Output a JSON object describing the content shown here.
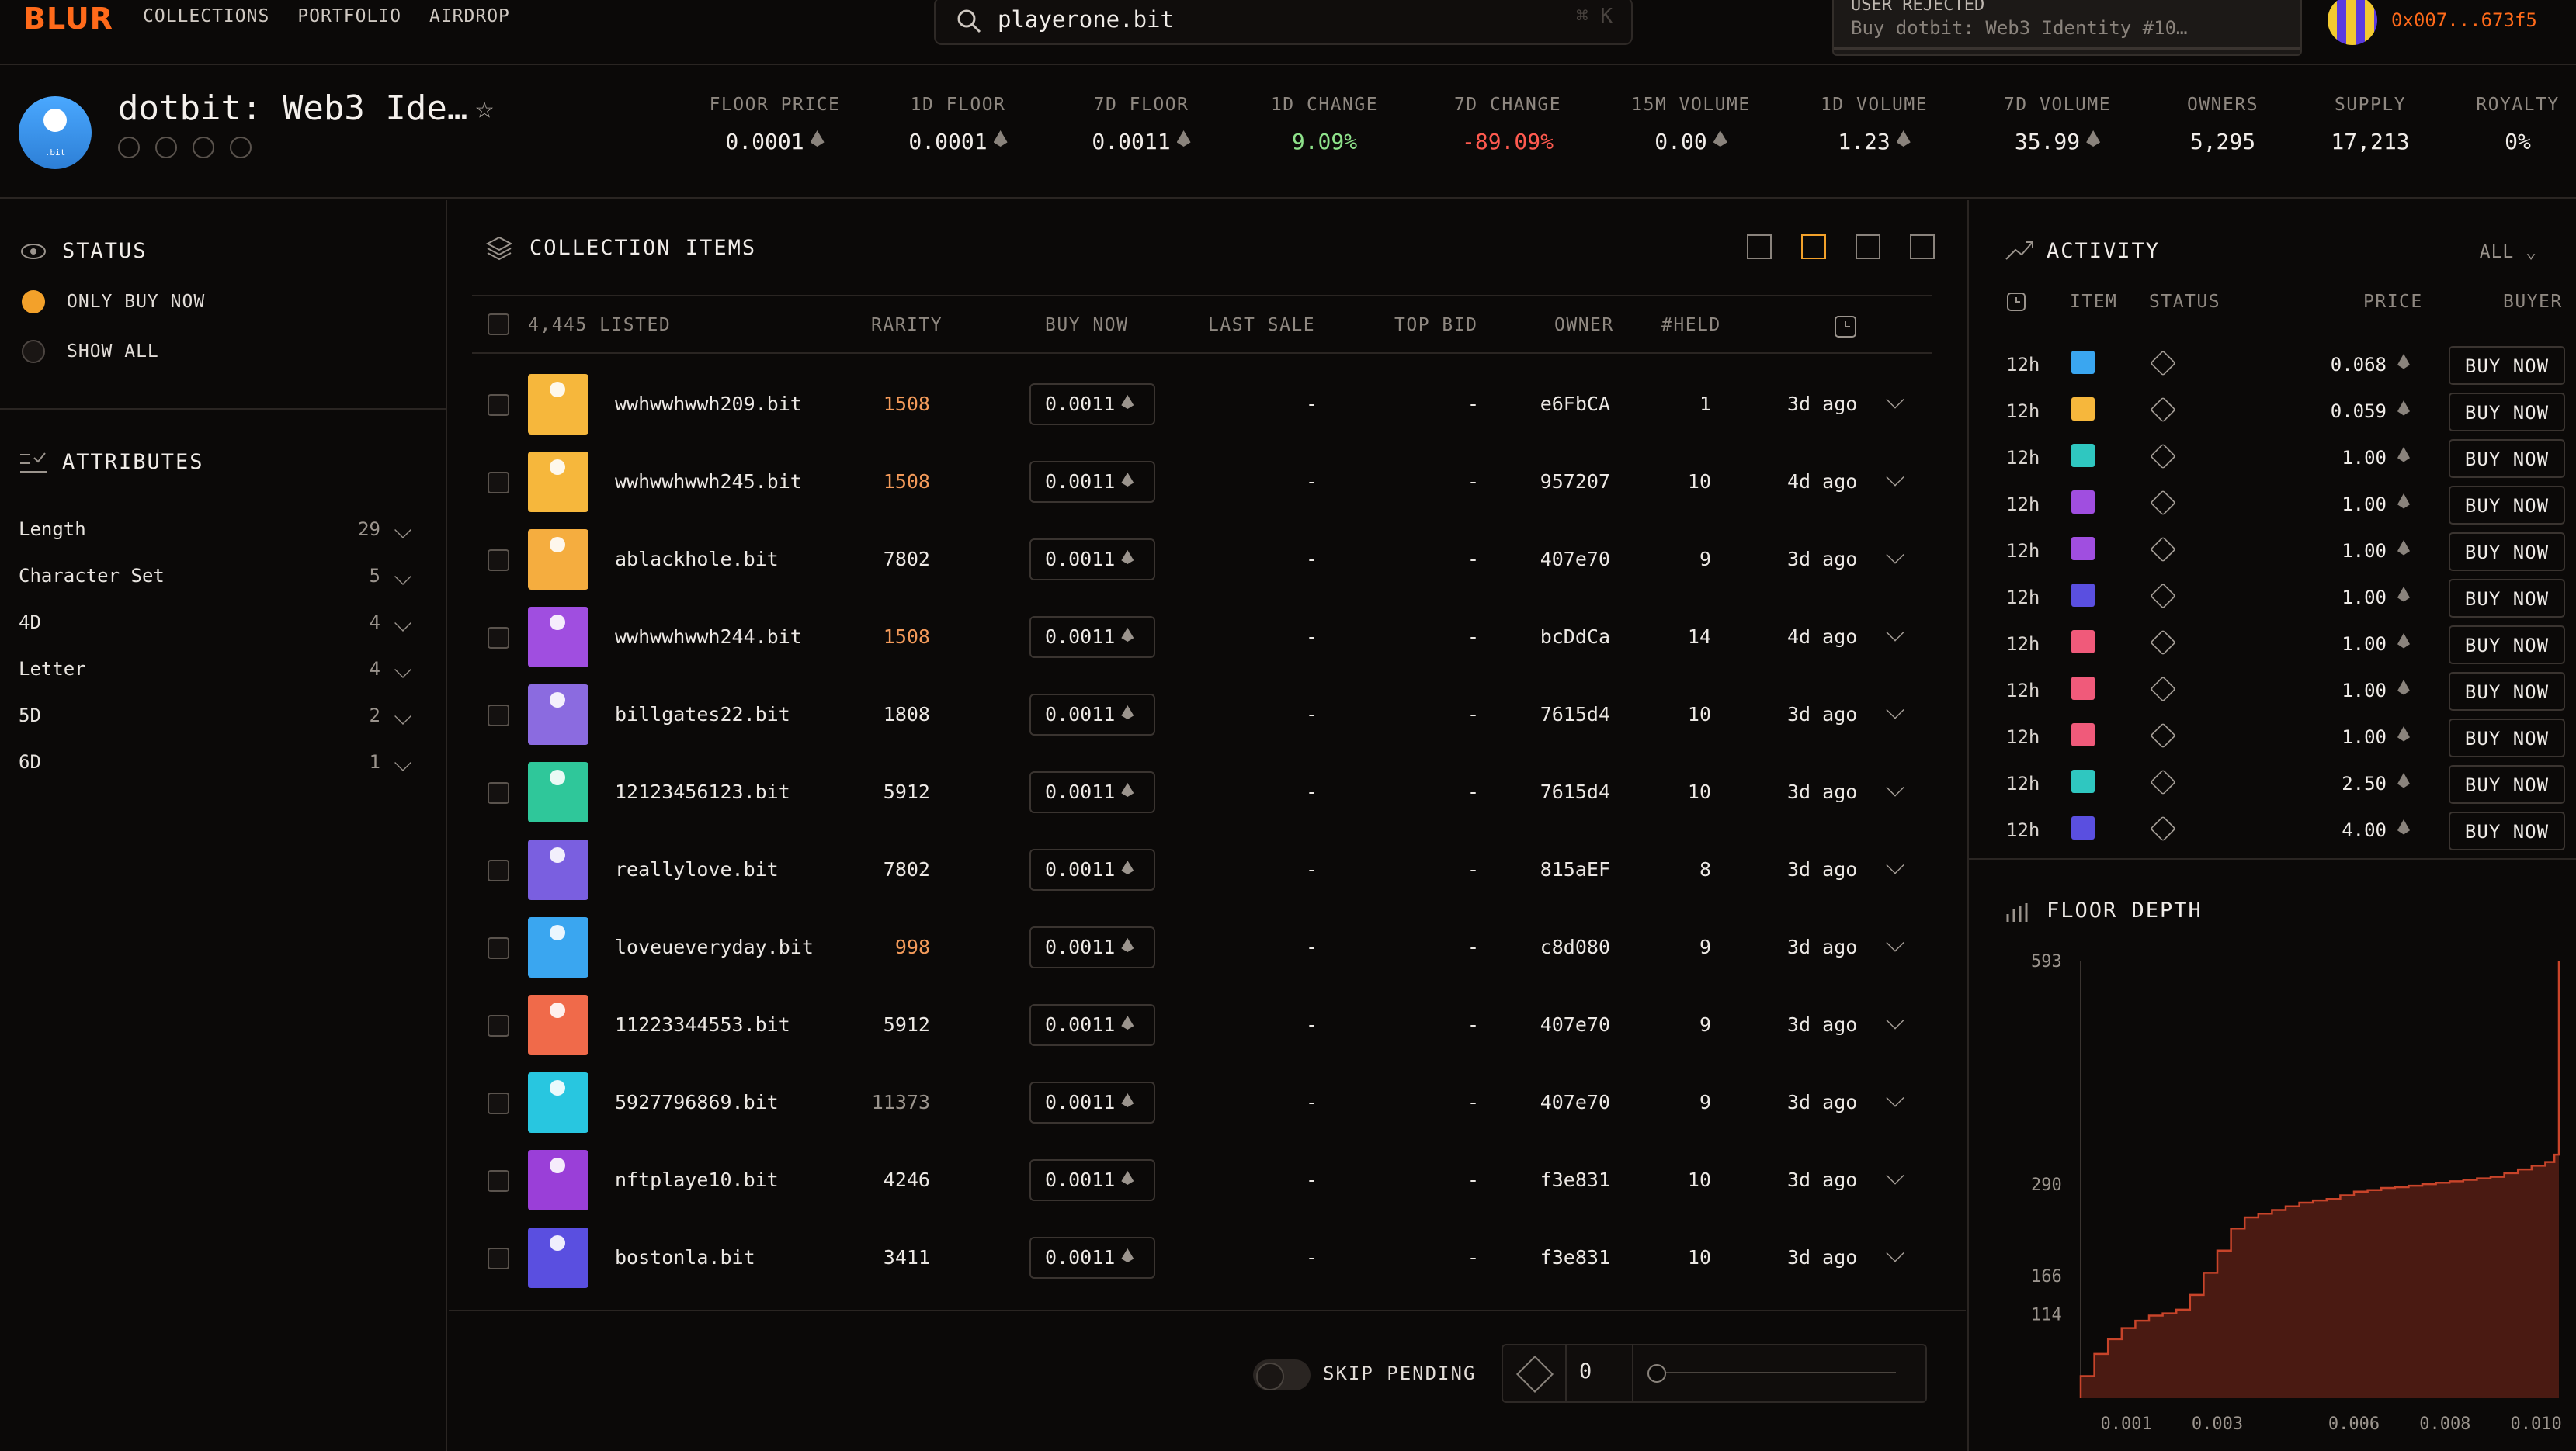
{
  "nav": {
    "logo": "BLUR",
    "links": [
      "COLLECTIONS",
      "PORTFOLIO",
      "AIRDROP"
    ]
  },
  "search": {
    "value": "playerone.bit",
    "shortcut": "⌘ K"
  },
  "toast": {
    "title": "USER REJECTED",
    "message": "Buy dotbit: Web3 Identity #10…"
  },
  "wallet": {
    "address": "0x007...673f5"
  },
  "collection": {
    "name": "dotbit: Web3 Ide…",
    "stats": [
      {
        "label": "FLOOR PRICE",
        "value": "0.0001",
        "eth": true,
        "tone": ""
      },
      {
        "label": "1D FLOOR",
        "value": "0.0001",
        "eth": true,
        "tone": ""
      },
      {
        "label": "7D FLOOR",
        "value": "0.0011",
        "eth": true,
        "tone": ""
      },
      {
        "label": "1D CHANGE",
        "value": "9.09%",
        "eth": false,
        "tone": "pos"
      },
      {
        "label": "7D CHANGE",
        "value": "-89.09%",
        "eth": false,
        "tone": "neg"
      },
      {
        "label": "15M VOLUME",
        "value": "0.00",
        "eth": true,
        "tone": ""
      },
      {
        "label": "1D VOLUME",
        "value": "1.23",
        "eth": true,
        "tone": ""
      },
      {
        "label": "7D VOLUME",
        "value": "35.99",
        "eth": true,
        "tone": ""
      },
      {
        "label": "OWNERS",
        "value": "5,295",
        "eth": false,
        "tone": ""
      },
      {
        "label": "SUPPLY",
        "value": "17,213",
        "eth": false,
        "tone": ""
      },
      {
        "label": "ROYALTY",
        "value": "0%",
        "eth": false,
        "tone": ""
      }
    ]
  },
  "status": {
    "title": "STATUS",
    "options": [
      {
        "label": "ONLY BUY NOW",
        "selected": true
      },
      {
        "label": "SHOW ALL",
        "selected": false
      }
    ]
  },
  "attributes": {
    "title": "ATTRIBUTES",
    "items": [
      {
        "name": "Length",
        "count": "29"
      },
      {
        "name": "Character Set",
        "count": "5"
      },
      {
        "name": "4D",
        "count": "4"
      },
      {
        "name": "Letter",
        "count": "4"
      },
      {
        "name": "5D",
        "count": "2"
      },
      {
        "name": "6D",
        "count": "1"
      }
    ]
  },
  "items": {
    "title": "COLLECTION ITEMS",
    "headers": {
      "listed": "4,445 LISTED",
      "rarity": "RARITY",
      "buy_now": "BUY NOW",
      "last_sale": "LAST SALE",
      "top_bid": "TOP BID",
      "owner": "OWNER",
      "held": "#HELD"
    },
    "rows": [
      {
        "name": "wwhwwhwwh209.bit",
        "rarity": "1508",
        "rarity_tone": "orange",
        "price": "0.0011",
        "last_sale": "-",
        "top_bid": "-",
        "owner": "e6FbCA",
        "held": "1",
        "age": "3d ago",
        "color": "#f6b73c"
      },
      {
        "name": "wwhwwhwwh245.bit",
        "rarity": "1508",
        "rarity_tone": "orange",
        "price": "0.0011",
        "last_sale": "-",
        "top_bid": "-",
        "owner": "957207",
        "held": "10",
        "age": "4d ago",
        "color": "#f6b73c"
      },
      {
        "name": "ablackhole.bit",
        "rarity": "7802",
        "rarity_tone": "",
        "price": "0.0011",
        "last_sale": "-",
        "top_bid": "-",
        "owner": "407e70",
        "held": "9",
        "age": "3d ago",
        "color": "#f5ad3f"
      },
      {
        "name": "wwhwwhwwh244.bit",
        "rarity": "1508",
        "rarity_tone": "orange",
        "price": "0.0011",
        "last_sale": "-",
        "top_bid": "-",
        "owner": "bcDdCa",
        "held": "14",
        "age": "4d ago",
        "color": "#a04ee0"
      },
      {
        "name": "billgates22.bit",
        "rarity": "1808",
        "rarity_tone": "",
        "price": "0.0011",
        "last_sale": "-",
        "top_bid": "-",
        "owner": "7615d4",
        "held": "10",
        "age": "3d ago",
        "color": "#8b6be0"
      },
      {
        "name": "12123456123.bit",
        "rarity": "5912",
        "rarity_tone": "",
        "price": "0.0011",
        "last_sale": "-",
        "top_bid": "-",
        "owner": "7615d4",
        "held": "10",
        "age": "3d ago",
        "color": "#2fc79a"
      },
      {
        "name": "reallylove.bit",
        "rarity": "7802",
        "rarity_tone": "",
        "price": "0.0011",
        "last_sale": "-",
        "top_bid": "-",
        "owner": "815aEF",
        "held": "8",
        "age": "3d ago",
        "color": "#7a5fe0"
      },
      {
        "name": "loveueveryday.bit",
        "rarity": "998",
        "rarity_tone": "orange",
        "price": "0.0011",
        "last_sale": "-",
        "top_bid": "-",
        "owner": "c8d080",
        "held": "9",
        "age": "3d ago",
        "color": "#3aa6f0"
      },
      {
        "name": "11223344553.bit",
        "rarity": "5912",
        "rarity_tone": "",
        "price": "0.0011",
        "last_sale": "-",
        "top_bid": "-",
        "owner": "407e70",
        "held": "9",
        "age": "3d ago",
        "color": "#f06a4a"
      },
      {
        "name": "5927796869.bit",
        "rarity": "11373",
        "rarity_tone": "dim",
        "price": "0.0011",
        "last_sale": "-",
        "top_bid": "-",
        "owner": "407e70",
        "held": "9",
        "age": "3d ago",
        "color": "#28c6e0"
      },
      {
        "name": "nftplaye10.bit",
        "rarity": "4246",
        "rarity_tone": "",
        "price": "0.0011",
        "last_sale": "-",
        "top_bid": "-",
        "owner": "f3e831",
        "held": "10",
        "age": "3d ago",
        "color": "#9a3fd8"
      },
      {
        "name": "bostonla.bit",
        "rarity": "3411",
        "rarity_tone": "",
        "price": "0.0011",
        "last_sale": "-",
        "top_bid": "-",
        "owner": "f3e831",
        "held": "10",
        "age": "3d ago",
        "color": "#5a4fe0"
      }
    ]
  },
  "sweep": {
    "skip_label": "SKIP PENDING",
    "count": "0"
  },
  "activity": {
    "title": "ACTIVITY",
    "filter": "ALL",
    "headers": {
      "item": "ITEM",
      "status": "STATUS",
      "price": "PRICE",
      "buyer": "BUYER"
    },
    "rows": [
      {
        "time": "12h",
        "price": "0.068",
        "action": "BUY NOW",
        "color": "#3aa6f0"
      },
      {
        "time": "12h",
        "price": "0.059",
        "action": "BUY NOW",
        "color": "#f6b73c"
      },
      {
        "time": "12h",
        "price": "1.00",
        "action": "BUY NOW",
        "color": "#2fc7c0"
      },
      {
        "time": "12h",
        "price": "1.00",
        "action": "BUY NOW",
        "color": "#a04ee0"
      },
      {
        "time": "12h",
        "price": "1.00",
        "action": "BUY NOW",
        "color": "#a04ee0"
      },
      {
        "time": "12h",
        "price": "1.00",
        "action": "BUY NOW",
        "color": "#5a4fe0"
      },
      {
        "time": "12h",
        "price": "1.00",
        "action": "BUY NOW",
        "color": "#f05a7a"
      },
      {
        "time": "12h",
        "price": "1.00",
        "action": "BUY NOW",
        "color": "#f05a7a"
      },
      {
        "time": "12h",
        "price": "1.00",
        "action": "BUY NOW",
        "color": "#f05a7a"
      },
      {
        "time": "12h",
        "price": "2.50",
        "action": "BUY NOW",
        "color": "#2fc7c0"
      },
      {
        "time": "12h",
        "price": "4.00",
        "action": "BUY NOW",
        "color": "#5a4fe0"
      }
    ]
  },
  "floor_depth": {
    "title": "FLOOR DEPTH",
    "chart_data": {
      "type": "area",
      "ylim": [
        0,
        593
      ],
      "xlim": [
        0.0,
        0.0105
      ],
      "y_ticks": [
        114,
        166,
        290,
        593
      ],
      "x_ticks": [
        "0.001",
        "0.003",
        "0.006",
        "0.008",
        "0.010"
      ],
      "x_tick_values": [
        0.001,
        0.003,
        0.006,
        0.008,
        0.01
      ],
      "x": [
        0.0,
        0.0003,
        0.0006,
        0.0009,
        0.0012,
        0.0015,
        0.0018,
        0.0021,
        0.0024,
        0.0027,
        0.003,
        0.0033,
        0.0036,
        0.0039,
        0.0042,
        0.0045,
        0.0048,
        0.0051,
        0.0054,
        0.0057,
        0.006,
        0.0063,
        0.0066,
        0.0069,
        0.0072,
        0.0075,
        0.0078,
        0.0081,
        0.0084,
        0.0087,
        0.009,
        0.0093,
        0.0096,
        0.0099,
        0.0102,
        0.0104,
        0.0105
      ],
      "values": [
        30,
        60,
        80,
        95,
        105,
        112,
        115,
        120,
        140,
        170,
        200,
        230,
        245,
        250,
        255,
        260,
        265,
        268,
        270,
        275,
        280,
        282,
        285,
        286,
        288,
        290,
        292,
        294,
        296,
        298,
        300,
        305,
        310,
        315,
        320,
        330,
        593
      ],
      "color": "#c8442a"
    }
  }
}
